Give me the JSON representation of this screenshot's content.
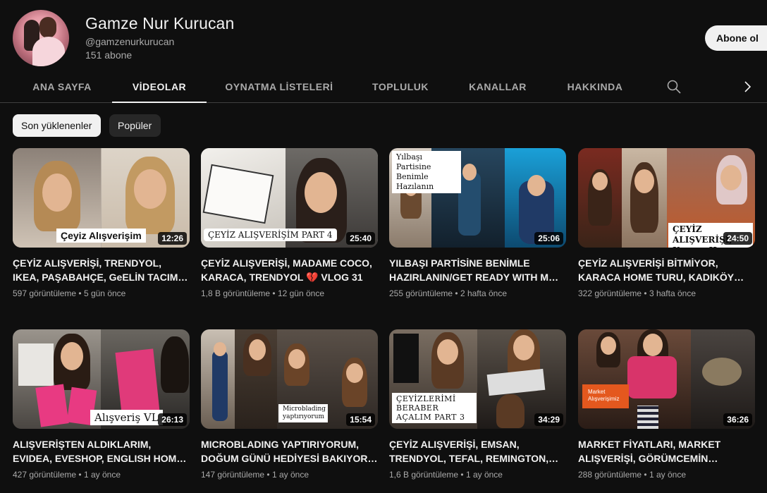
{
  "channel": {
    "name": "Gamze Nur Kurucan",
    "handle": "@gamzenurkurucan",
    "subscribers": "151 abone",
    "subscribe_label": "Abone ol"
  },
  "tabs": [
    {
      "label": "ANA SAYFA",
      "active": false
    },
    {
      "label": "VİDEOLAR",
      "active": true
    },
    {
      "label": "OYNATMA LİSTELERİ",
      "active": false
    },
    {
      "label": "TOPLULUK",
      "active": false
    },
    {
      "label": "KANALLAR",
      "active": false
    },
    {
      "label": "HAKKINDA",
      "active": false
    }
  ],
  "filters": {
    "latest": "Son yüklenenler",
    "popular": "Popüler"
  },
  "videos": [
    {
      "title": "ÇEYİZ ALIŞVERİŞİ, TRENDYOL, IKEA, PAŞABAHÇE, GeELİN TACIM…",
      "views": "597 görüntüleme",
      "age": "5 gün önce",
      "duration": "12:26",
      "thumb_text": "Çeyiz Alışverişim"
    },
    {
      "title": "ÇEYİZ ALIŞVERİŞİ, MADAME COCO, KARACA, TRENDYOL 💔 VLOG 31",
      "views": "1,8 B görüntüleme",
      "age": "12 gün önce",
      "duration": "25:40",
      "thumb_text": "ÇEYİZ ALIŞVERİŞİM PART 4"
    },
    {
      "title": "YILBAŞI PARTİSİNE BENİMLE HAZIRLANIN/GET READY WITH M…",
      "views": "255 görüntüleme",
      "age": "2 hafta önce",
      "duration": "25:06",
      "thumb_text": "Yılbaşı Partisine Benimle Hazılanın"
    },
    {
      "title": "ÇEYİZ ALIŞVERİŞİ BİTMİYOR, KARACA HOME TURU, KADIKÖY…",
      "views": "322 görüntüleme",
      "age": "3 hafta önce",
      "duration": "24:50",
      "thumb_text": "ÇEYİZ ALIŞVERİŞİ, Karaca Home"
    },
    {
      "title": "ALIŞVERİŞTEN ALDIKLARIM, EVIDEA, EVESHOP, ENGLISH HOM…",
      "views": "427 görüntüleme",
      "age": "1 ay önce",
      "duration": "26:13",
      "thumb_text": "Alışveriş VL"
    },
    {
      "title": "MICROBLADING YAPTIRIYORUM, DOĞUM GÜNÜ HEDİYESİ BAKIYOR…",
      "views": "147 görüntüleme",
      "age": "1 ay önce",
      "duration": "15:54",
      "thumb_text": "Microblading yaptırıyorum"
    },
    {
      "title": "ÇEYİZ ALIŞVERİŞİ, EMSAN, TRENDYOL, TEFAL, REMINGTON,…",
      "views": "1,6 B görüntüleme",
      "age": "1 ay önce",
      "duration": "34:29",
      "thumb_text": "ÇEYİZLERİMİ BERABER AÇALIM PART 3"
    },
    {
      "title": "MARKET FİYATLARI, MARKET ALIŞVERİŞİ, GÖRÜMCEMİN…",
      "views": "288 görüntüleme",
      "age": "1 ay önce",
      "duration": "36:26",
      "thumb_text": "Market Alışverişimiz"
    }
  ]
}
